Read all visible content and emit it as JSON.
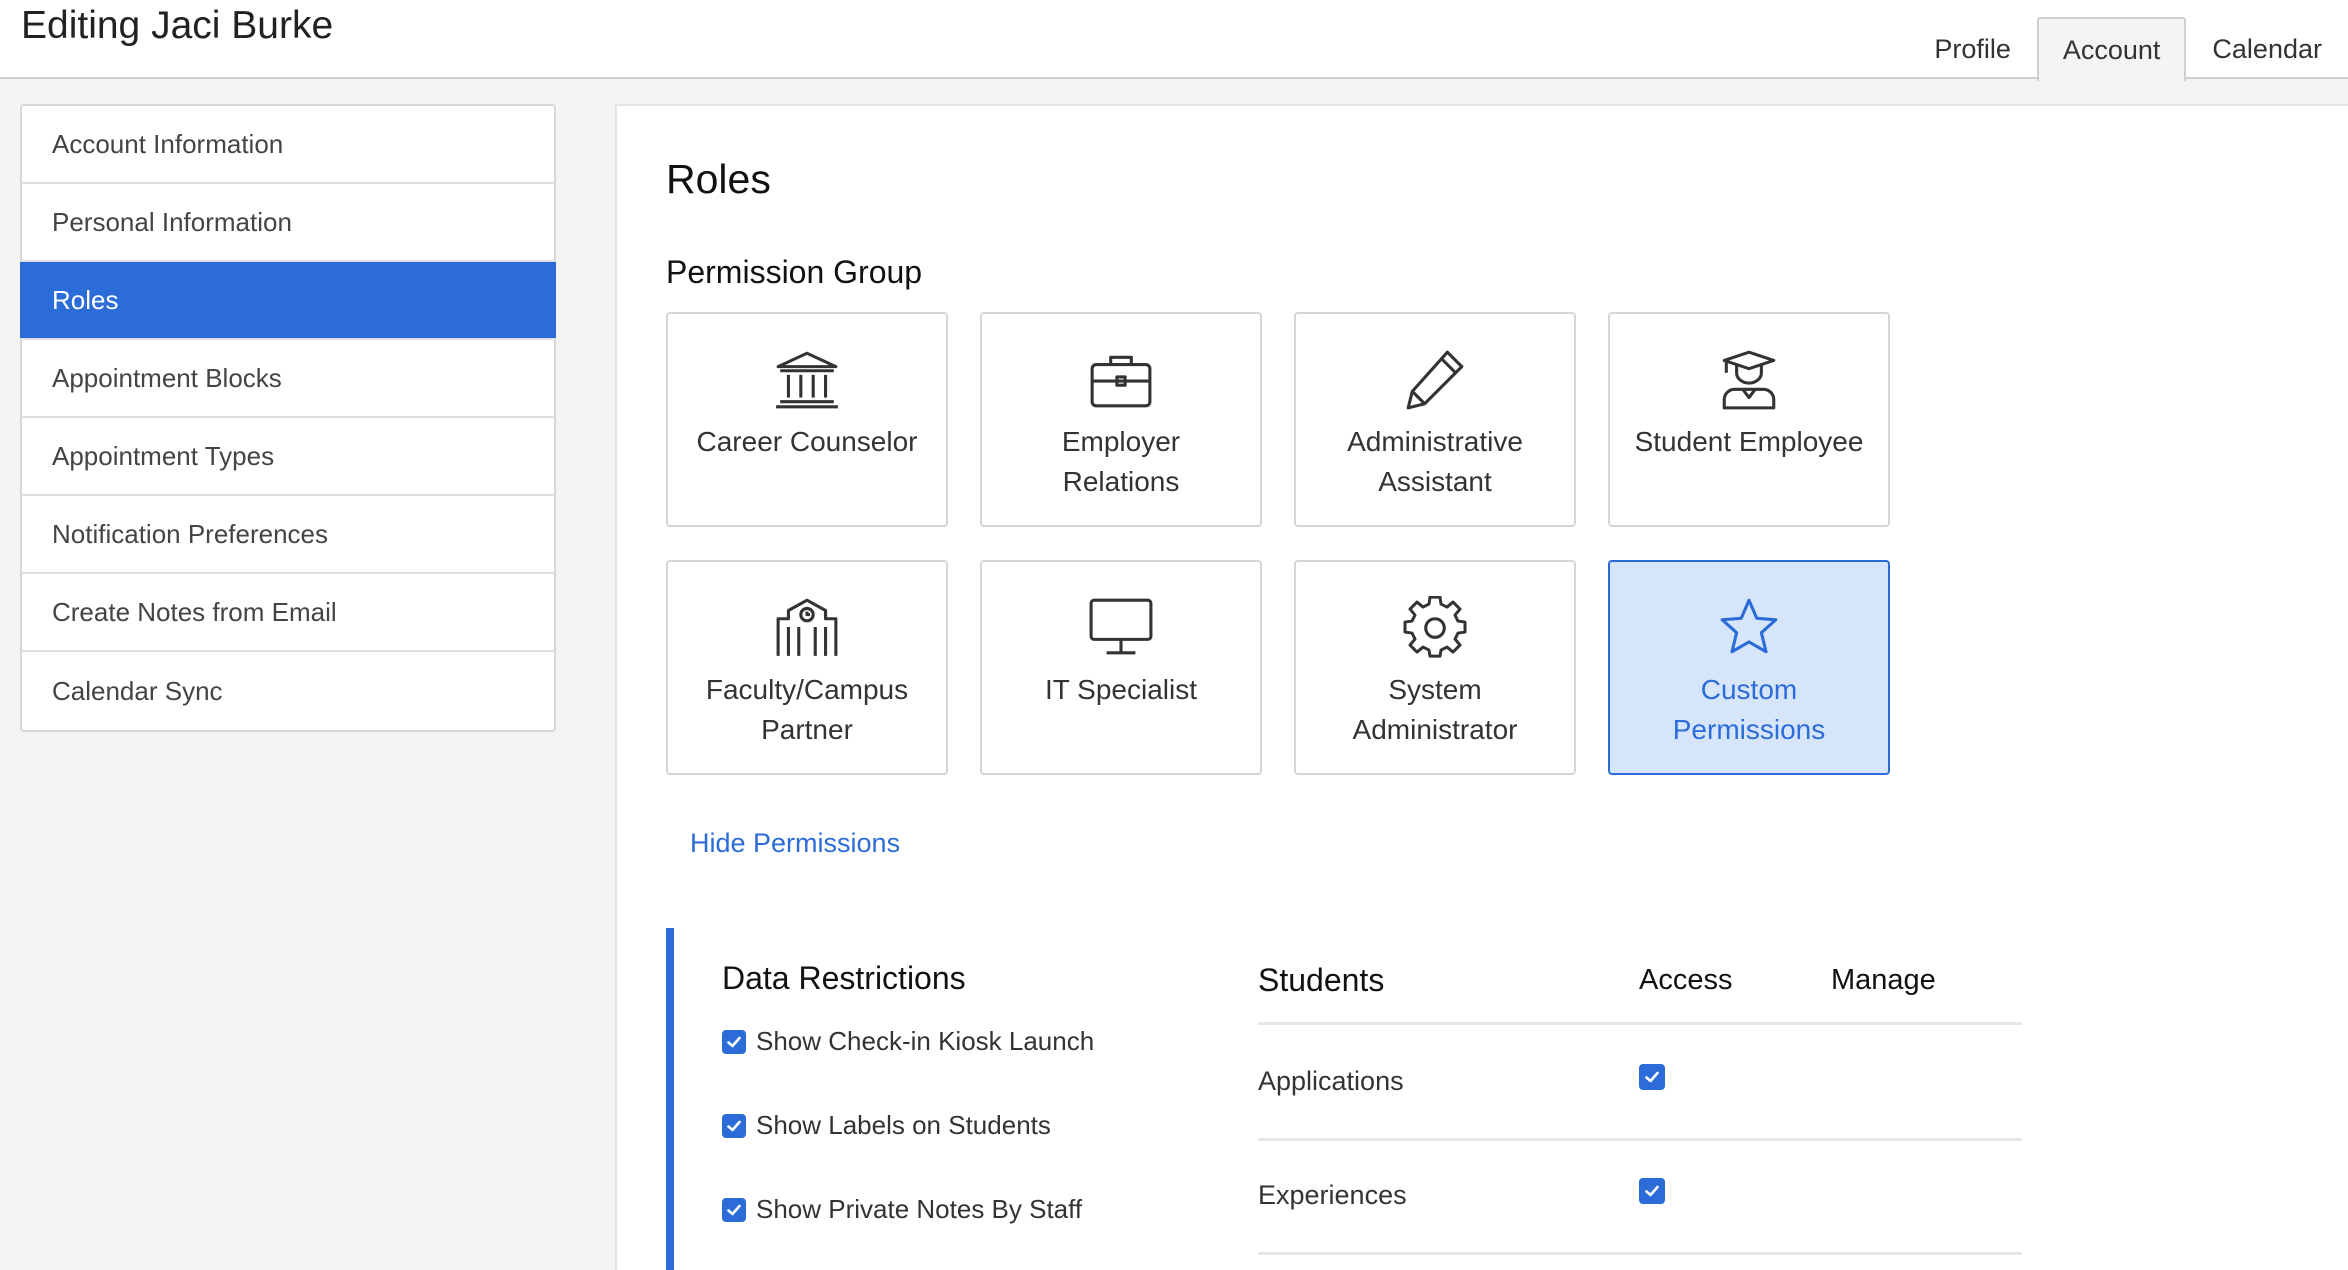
{
  "header": {
    "title": "Editing Jaci Burke",
    "tabs": [
      {
        "label": "Profile"
      },
      {
        "label": "Account"
      },
      {
        "label": "Calendar"
      }
    ]
  },
  "sidebar": {
    "items": [
      {
        "label": "Account Information"
      },
      {
        "label": "Personal Information"
      },
      {
        "label": "Roles"
      },
      {
        "label": "Appointment Blocks"
      },
      {
        "label": "Appointment Types"
      },
      {
        "label": "Notification Preferences"
      },
      {
        "label": "Create Notes from Email"
      },
      {
        "label": "Calendar Sync"
      }
    ],
    "active_index": 2
  },
  "main": {
    "title": "Roles",
    "group_title": "Permission Group",
    "cards": [
      {
        "label": "Career Counselor",
        "icon": "bank-icon"
      },
      {
        "label": "Employer Relations",
        "icon": "briefcase-icon"
      },
      {
        "label": "Administrative Assistant",
        "icon": "pencil-icon"
      },
      {
        "label": "Student Employee",
        "icon": "graduate-icon"
      },
      {
        "label": "Faculty/Campus Partner",
        "icon": "campus-building-icon"
      },
      {
        "label": "IT Specialist",
        "icon": "monitor-icon"
      },
      {
        "label": "System Administrator",
        "icon": "gear-icon"
      },
      {
        "label": "Custom Permissions",
        "icon": "star-icon"
      }
    ],
    "selected_card_index": 7,
    "hide_link": "Hide Permissions"
  },
  "permissions": {
    "data_title": "Data Restrictions",
    "checks": [
      {
        "label": "Show Check-in Kiosk Launch",
        "checked": true
      },
      {
        "label": "Show Labels on Students",
        "checked": true
      },
      {
        "label": "Show Private Notes By Staff",
        "checked": true
      }
    ],
    "students_title": "Students",
    "columns": [
      "Access",
      "Manage"
    ],
    "rows": [
      {
        "label": "Applications",
        "access": true,
        "manage": false
      },
      {
        "label": "Experiences",
        "access": true,
        "manage": false
      }
    ]
  },
  "colors": {
    "accent": "#2b6cd8",
    "selected_card_bg": "#d7e5fa",
    "page_bg": "#f4f4f4"
  }
}
